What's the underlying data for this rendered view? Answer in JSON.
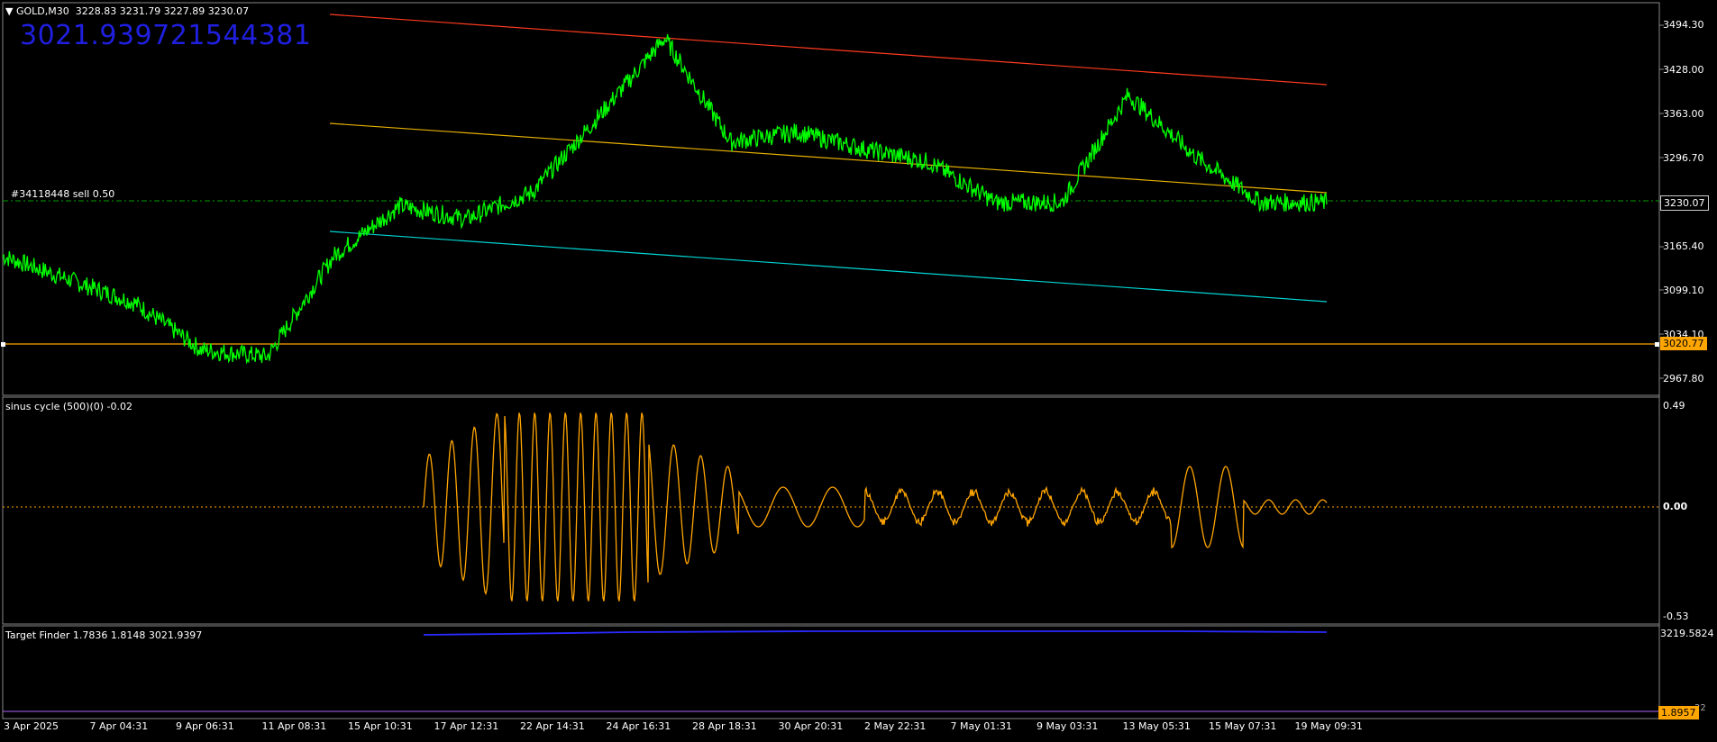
{
  "symbol_header": {
    "symbol": "GOLD,M30",
    "ohlc": "3228.83 3231.79 3227.89 3230.07"
  },
  "overlay_text": "3021.939721544381",
  "order_label": "#34118448 sell 0.50",
  "price_axis": {
    "ticks": [
      "3494.30",
      "3428.00",
      "3363.00",
      "3296.70",
      "3165.40",
      "3099.10",
      "3034.10",
      "2967.80"
    ],
    "current_price": "3230.07",
    "hline_price": "3020.77"
  },
  "sinus_panel": {
    "label": "sinus cycle (500)(0) -0.02",
    "ticks": [
      "0.49",
      "0.00",
      "-0.53"
    ]
  },
  "target_panel": {
    "label": "Target Finder 1.7836 1.8148 3021.9397",
    "ticks": [
      "3219.5824",
      "1.8957",
      "22"
    ]
  },
  "time_axis": {
    "ticks": [
      "3 Apr 2025",
      "7 Apr 04:31",
      "9 Apr 06:31",
      "11 Apr 08:31",
      "15 Apr 10:31",
      "17 Apr 12:31",
      "22 Apr 14:31",
      "24 Apr 16:31",
      "28 Apr 18:31",
      "30 Apr 20:31",
      "2 May 22:31",
      "7 May 01:31",
      "9 May 03:31",
      "13 May 05:31",
      "15 May 07:31",
      "19 May 09:31"
    ]
  },
  "colors": {
    "price_line": "#00ff00",
    "upper_channel": "#ff3b1f",
    "mid_channel": "#e6b000",
    "lower_channel": "#00d5d5",
    "oscillator": "#ffa500",
    "target_line": "#2a2aff",
    "hline": "#ffa500",
    "current_price_line": "#00a000"
  },
  "chart_data": [
    {
      "type": "line",
      "title": "GOLD,M30",
      "series": [],
      "x": [
        0,
        0.05,
        0.1,
        0.15,
        0.2,
        0.25,
        0.3,
        0.35,
        0.4,
        0.45,
        0.5,
        0.55,
        0.6,
        0.65,
        0.7,
        0.75,
        0.8,
        0.85,
        0.9,
        0.95,
        1.0
      ],
      "values": [
        3150,
        3115,
        3080,
        3010,
        3000,
        3150,
        3225,
        3205,
        3245,
        3358,
        3475,
        3320,
        3335,
        3310,
        3290,
        3230,
        3230,
        3390,
        3300,
        3230,
        3230
      ],
      "ylim": [
        2940,
        3520
      ]
    }
  ]
}
